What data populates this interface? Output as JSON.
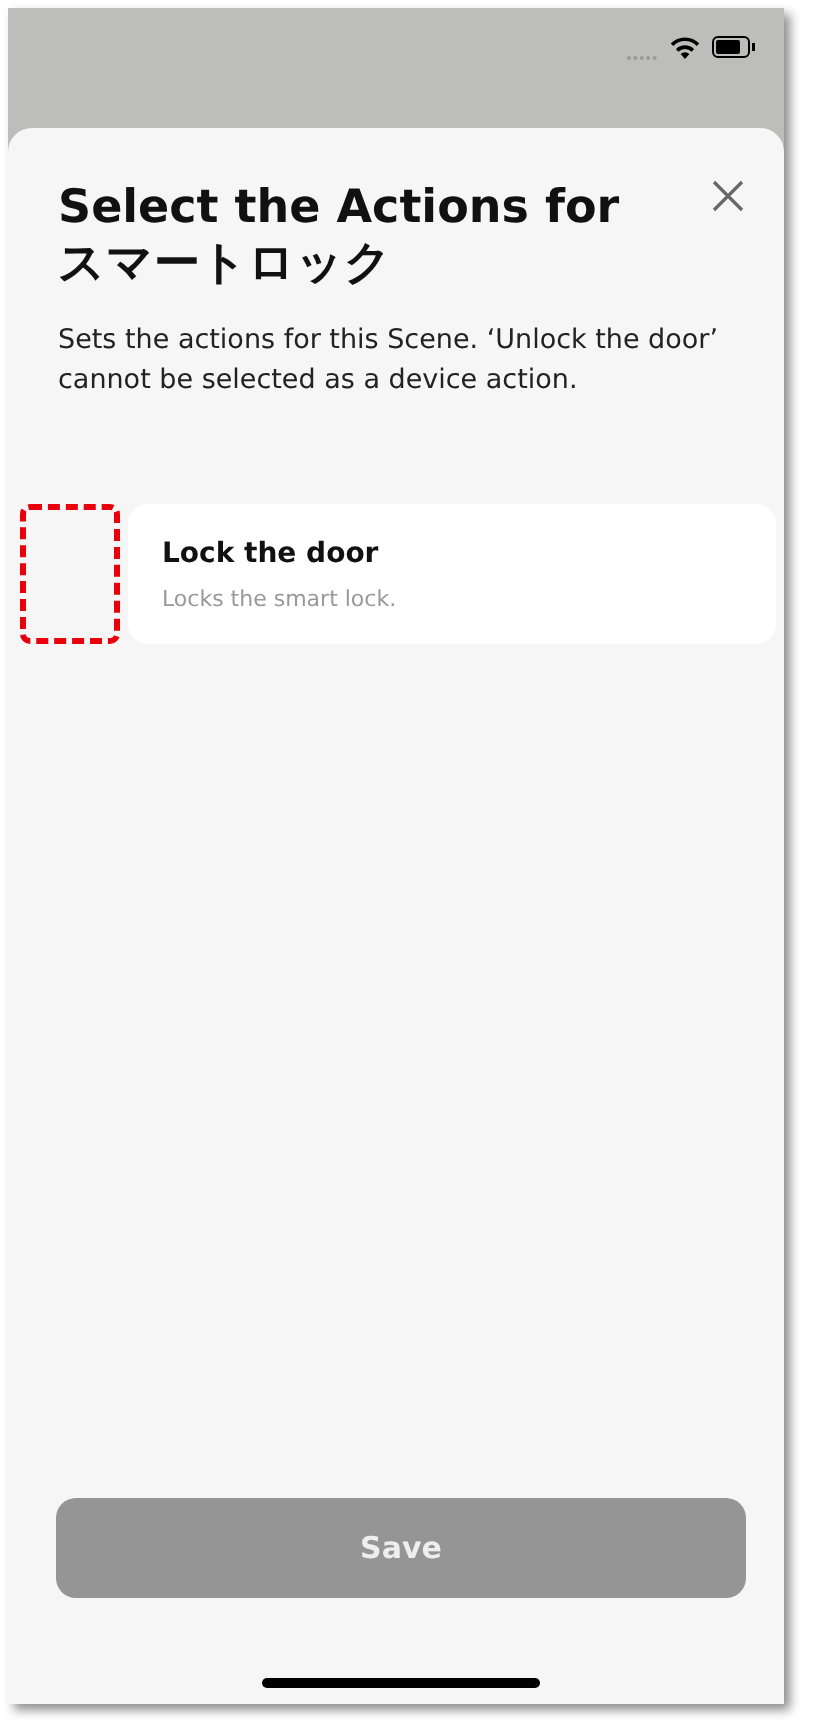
{
  "sheet": {
    "title": "Select the Actions for スマートロック",
    "description": "Sets the actions for this Scene. ‘Unlock the door’ cannot be selected as a device action."
  },
  "actions": [
    {
      "title": "Lock the door",
      "subtitle": "Locks the smart lock.",
      "highlighted": true
    }
  ],
  "save_button": {
    "label": "Save",
    "disabled": true
  }
}
